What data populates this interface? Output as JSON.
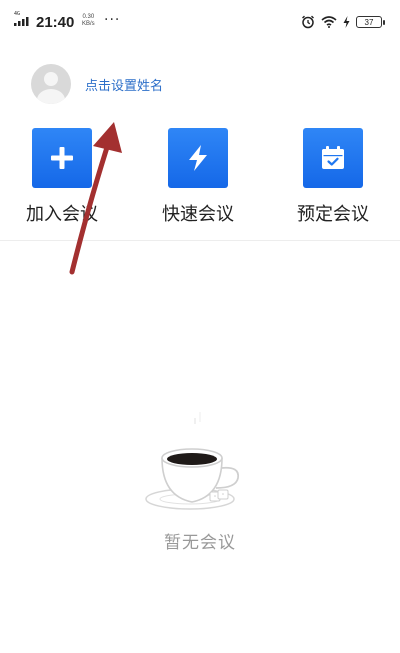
{
  "status_bar": {
    "network": "4G",
    "time": "21:40",
    "speed_value": "0.30",
    "speed_unit": "KB/s",
    "more": "···",
    "battery": "37",
    "icons": [
      "signal-icon",
      "alarm-icon",
      "wifi-icon",
      "charging-icon",
      "battery-icon"
    ]
  },
  "profile": {
    "name_prompt": "点击设置姓名",
    "avatar_icon": "default-avatar-icon"
  },
  "actions": [
    {
      "label": "加入会议",
      "icon": "plus-icon"
    },
    {
      "label": "快速会议",
      "icon": "lightning-icon"
    },
    {
      "label": "预定会议",
      "icon": "calendar-check-icon"
    }
  ],
  "empty_state": {
    "text": "暂无会议",
    "icon": "coffee-cup-icon"
  },
  "colors": {
    "accent": "#1f77f0",
    "name_link": "#2d6fc9",
    "annotation_arrow": "#a33030",
    "empty_text": "#999999"
  }
}
